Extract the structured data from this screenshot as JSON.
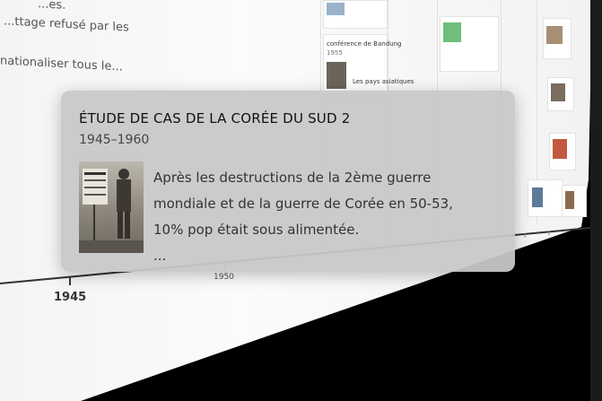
{
  "background": {
    "text_lines": [
      "...es.",
      "...ttage refusé par les",
      "nationaliser tous le..."
    ],
    "mini_titles": [
      "conférence de Bandung",
      "1955",
      "Les pays asiatiques"
    ],
    "years": [
      "1945",
      "1950"
    ]
  },
  "popup": {
    "title": "ÉTUDE DE CAS DE LA CORÉE DU SUD 2",
    "dates": "1945–1960",
    "lines": [
      "Après les destructions de la 2ème guerre",
      "mondiale et de la guerre de Corée en 50-53,",
      "10% pop était sous alimentée.",
      "..."
    ]
  },
  "colors": {
    "popup_bg": "#c8c8c8",
    "plane": "#f4f4f4",
    "ink": "#333333"
  }
}
